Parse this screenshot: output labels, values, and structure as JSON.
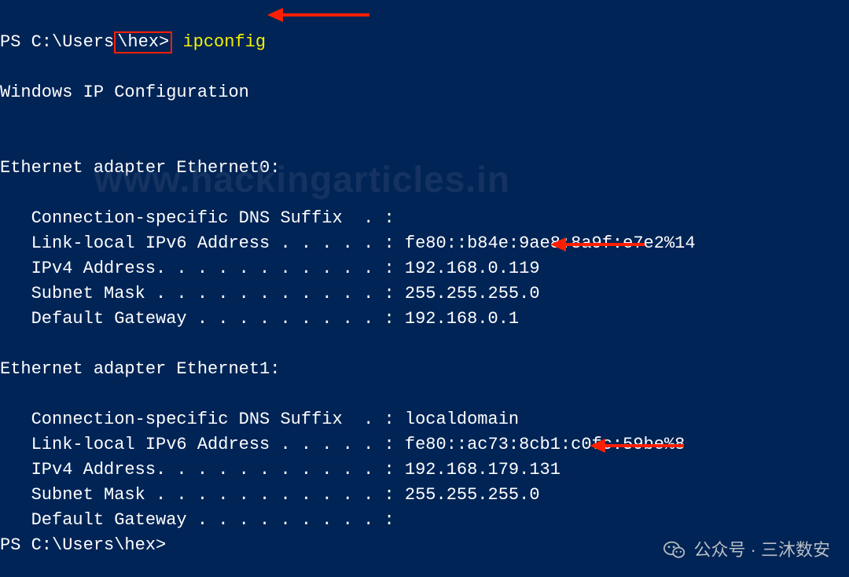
{
  "prompt1": {
    "prefix": "PS C:\\Users",
    "boxed": "\\hex>",
    "command": "ipconfig"
  },
  "header": "Windows IP Configuration",
  "watermark": "www.hackingarticles.in",
  "adapter0": {
    "title": "Ethernet adapter Ethernet0:",
    "dns_label": "   Connection-specific DNS Suffix  . :",
    "dns_value": "",
    "ipv6_label": "   Link-local IPv6 Address . . . . . : ",
    "ipv6_value": "fe80::b84e:9ae8:8a9f:e7e2%14",
    "ipv4_label": "   IPv4 Address. . . . . . . . . . . : ",
    "ipv4_value": "192.168.0.119",
    "mask_label": "   Subnet Mask . . . . . . . . . . . : ",
    "mask_value": "255.255.255.0",
    "gw_label": "   Default Gateway . . . . . . . . . : ",
    "gw_value": "192.168.0.1"
  },
  "adapter1": {
    "title": "Ethernet adapter Ethernet1:",
    "dns_label": "   Connection-specific DNS Suffix  . : ",
    "dns_value": "localdomain",
    "ipv6_label": "   Link-local IPv6 Address . . . . . : ",
    "ipv6_value": "fe80::ac73:8cb1:c0fc:59be%8",
    "ipv4_label": "   IPv4 Address. . . . . . . . . . . : ",
    "ipv4_value": "192.168.179.131",
    "mask_label": "   Subnet Mask . . . . . . . . . . . : ",
    "mask_value": "255.255.255.0",
    "gw_label": "   Default Gateway . . . . . . . . . :",
    "gw_value": ""
  },
  "prompt2": "PS C:\\Users\\hex>",
  "footer": {
    "text": "公众号 · 三沐数安"
  }
}
